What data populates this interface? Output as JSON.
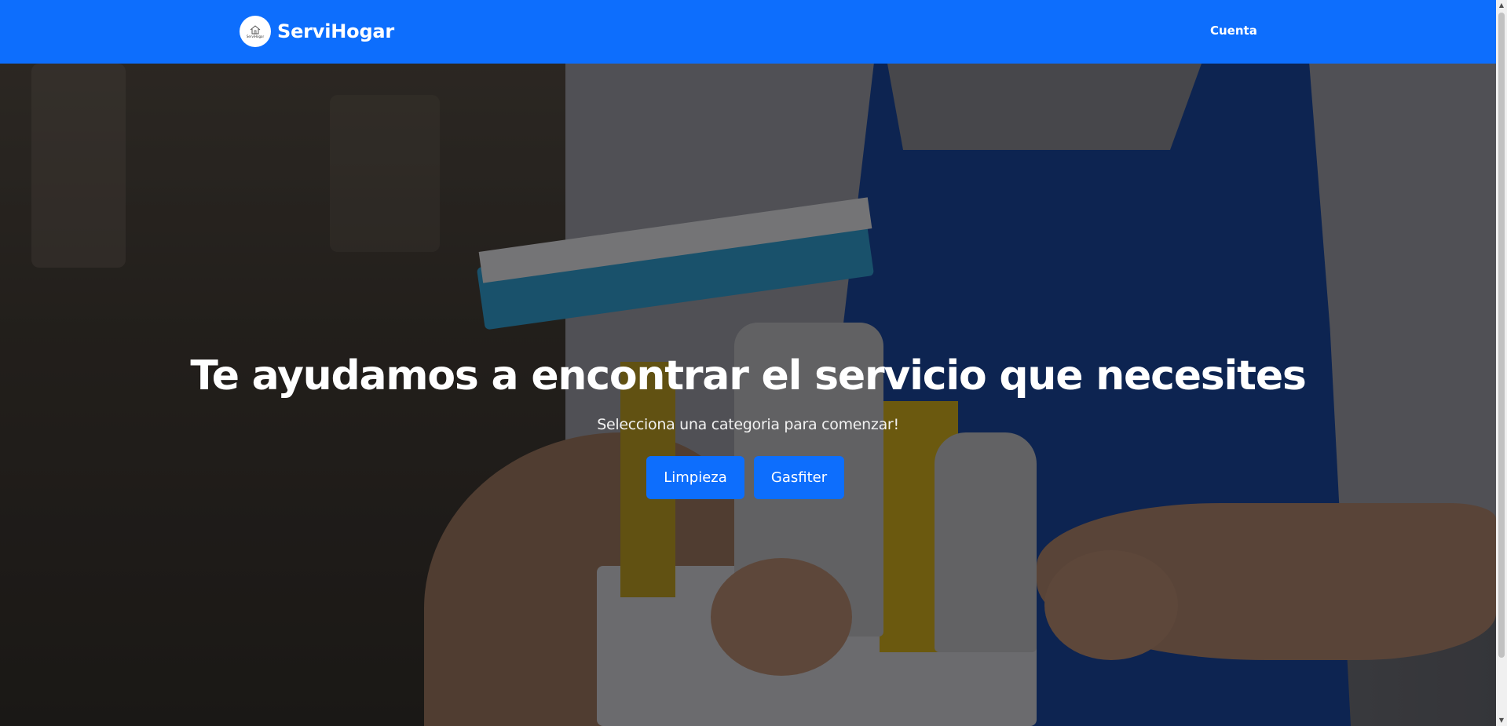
{
  "navbar": {
    "brand_name": "ServiHogar",
    "logo_text": "ServiHogar",
    "account_link": "Cuenta",
    "background_color": "#0d6efd"
  },
  "hero": {
    "title": "Te ayudamos a encontrar el servicio que necesites",
    "subtitle": "Selecciona una categoria para comenzar!",
    "categories": [
      {
        "label": "Limpieza"
      },
      {
        "label": "Gasfiter"
      }
    ],
    "button_color": "#0d6efd",
    "background_image": "cleaner-with-blue-apron-holding-cleaning-supplies"
  },
  "icons": {
    "logo": "house-icon",
    "scroll_up": "triangle-up-icon",
    "scroll_down": "triangle-down-icon"
  }
}
